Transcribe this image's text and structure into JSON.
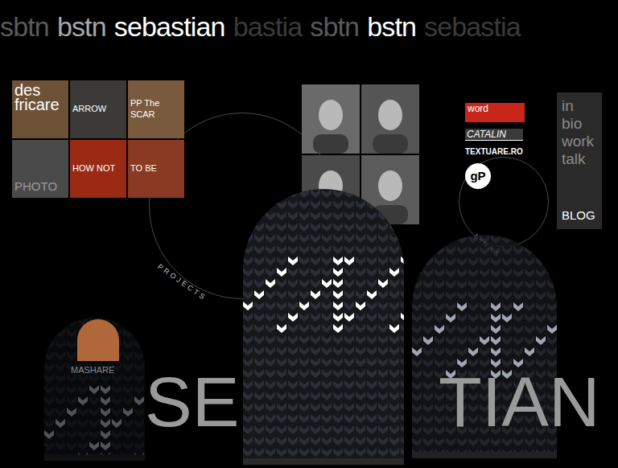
{
  "header": {
    "words": [
      {
        "text": "sbtn",
        "color": "#5a5a5a"
      },
      {
        "text": "bstn",
        "color": "#a8a8a8"
      },
      {
        "text": "sebastian",
        "color": "#ffffff"
      },
      {
        "text": "bastia",
        "color": "#3a3a3a"
      },
      {
        "text": "sbtn",
        "color": "#5a5a5a"
      },
      {
        "text": "bstn",
        "color": "#ffffff"
      },
      {
        "text": "sebastia",
        "color": "#3a3a3a"
      }
    ]
  },
  "projects": {
    "label": "PROJECTS",
    "tiles": [
      {
        "label": "des fricare",
        "kind": "title",
        "color": "#6e5238"
      },
      {
        "label": "ARROW",
        "kind": "caption",
        "color": "#3c3a38"
      },
      {
        "label": "PP The SCAR",
        "kind": "caption",
        "color": "#7a5a3e"
      },
      {
        "label": "PHOTO",
        "kind": "bottom",
        "color": "#4a4a4a"
      },
      {
        "label": "HOW NOT",
        "kind": "caption",
        "color": "#9a2a14"
      },
      {
        "label": "TO BE",
        "kind": "caption",
        "color": "#8a3a22"
      }
    ]
  },
  "links": {
    "label": "LINKS",
    "items": [
      {
        "text": "word",
        "kind": "word-logo"
      },
      {
        "text": "CATALIN",
        "kind": "bar"
      },
      {
        "text": "TEXTUARE.RO",
        "kind": "plain"
      },
      {
        "text": "gP",
        "kind": "circle-logo"
      }
    ]
  },
  "menu": {
    "items": [
      "in",
      "bio",
      "work",
      "talk"
    ],
    "blog": "BLOG"
  },
  "big_name": {
    "left": "SE",
    "right": "TIAN"
  },
  "product": {
    "label": "MASHARE"
  }
}
